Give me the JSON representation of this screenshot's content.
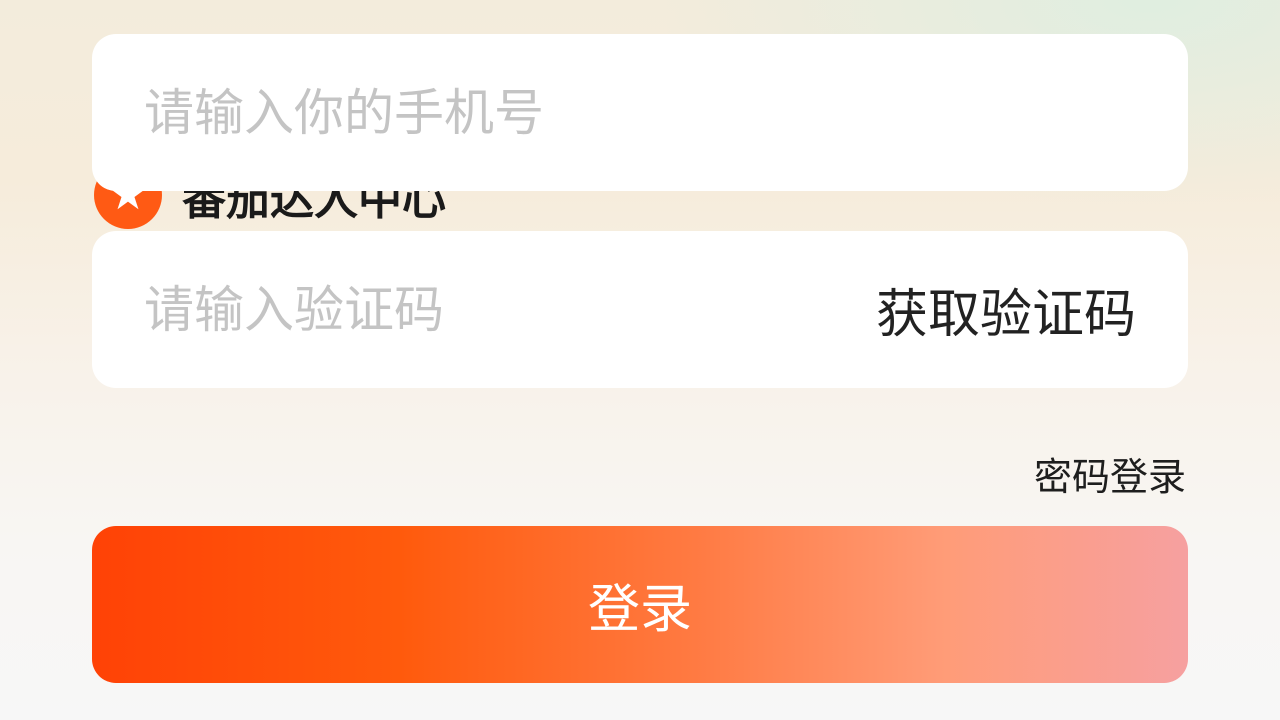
{
  "brand": {
    "icon": "star-logo-icon",
    "name": "番茄达人中心",
    "color": "#ff5a14"
  },
  "form": {
    "phone_placeholder": "请输入你的手机号",
    "code_placeholder": "请输入验证码",
    "get_code_label": "获取验证码",
    "password_login_label": "密码登录",
    "submit_label": "登录"
  },
  "colors": {
    "primary": "#ff4a0a",
    "gradient_end": "#f6a0a0",
    "placeholder": "#c4c4c4",
    "text": "#222222"
  }
}
